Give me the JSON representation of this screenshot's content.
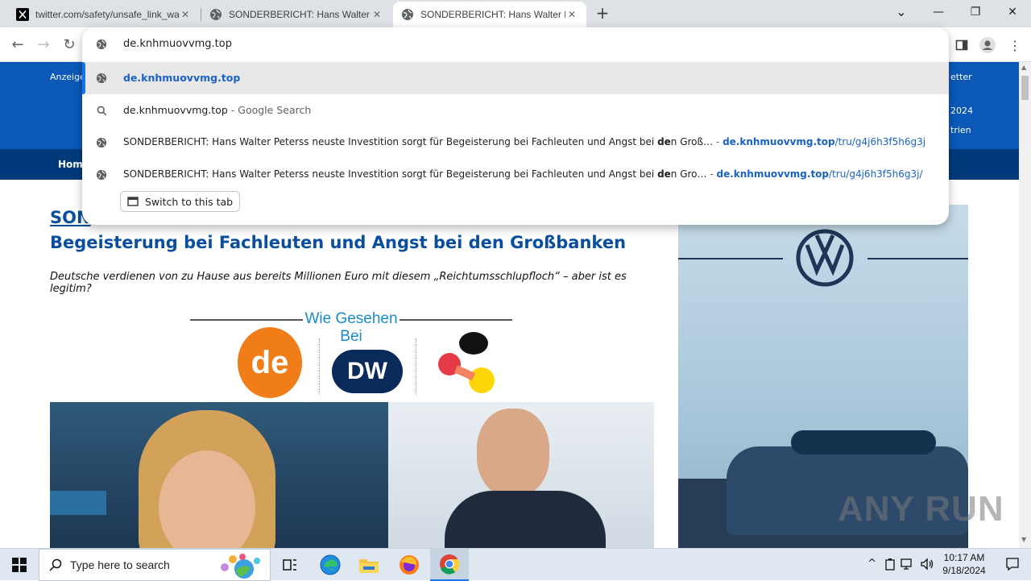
{
  "tabs": [
    {
      "title": "twitter.com/safety/unsafe_link_warning",
      "active": false
    },
    {
      "title": "SONDERBERICHT: Hans Walter P",
      "active": false
    },
    {
      "title": "SONDERBERICHT: Hans Walter P",
      "active": true
    }
  ],
  "window_controls": {
    "minimize": "—",
    "restore": "❐",
    "close": "✕",
    "dropdown": "⌄"
  },
  "toolbar": {
    "back": "←",
    "forward": "→",
    "reload": "↻"
  },
  "omnibox": {
    "input_value": "de.knhmuovvmg.top",
    "suggestions": [
      {
        "kind": "url",
        "url": "de.knhmuovvmg.top"
      },
      {
        "kind": "search",
        "query": "de.knhmuovvmg.top",
        "separator": " - ",
        "engine": "Google Search"
      },
      {
        "kind": "history",
        "title_before": "SONDERBERICHT: Hans Walter Peterss neuste Investition sorgt für Begeisterung bei Fachleuten und Angst bei ",
        "title_bold": "de",
        "title_after": "n Groß…",
        "separator": " - ",
        "url": "de.knhmuovvmg.top",
        "path": "/tru/g4j6h3f5h6g3j"
      },
      {
        "kind": "tab",
        "title_before": "SONDERBERICHT: Hans Walter Peterss neuste Investition sorgt für Begeisterung bei Fachleuten und Angst bei ",
        "title_bold": "de",
        "title_after": "n Gro…",
        "separator": " - ",
        "url": "de.knhmuovvmg.top",
        "path": "/tru/g4j6h3f5h6g3j/"
      }
    ],
    "switch_tab_label": "Switch to this tab"
  },
  "page": {
    "topbar_left": "Anzeige",
    "topbar_right": "etter",
    "banner_right_1": "2024",
    "banner_right_2": "trien",
    "nav_home": "Home",
    "headline_part1": "SON",
    "headline_line2": "Begeisterung bei Fachleuten und Angst bei den Großbanken",
    "subline": "Deutsche verdienen von zu Hause aus bereits Millionen Euro mit diesem „Reichtumsschlupfloch“ – aber ist es legitim?",
    "seen_on": "Wie Gesehen Bei",
    "logo_de": "de",
    "logo_dw": "DW"
  },
  "watermark": "ANY RUN",
  "taskbar": {
    "search_placeholder": "Type here to search",
    "time": "10:17 AM",
    "date": "9/18/2024"
  },
  "colors": {
    "brand_blue": "#0a58b7",
    "nav_dark": "#003a7a",
    "link_blue": "#1a62c6",
    "headline": "#0a4f9e"
  }
}
